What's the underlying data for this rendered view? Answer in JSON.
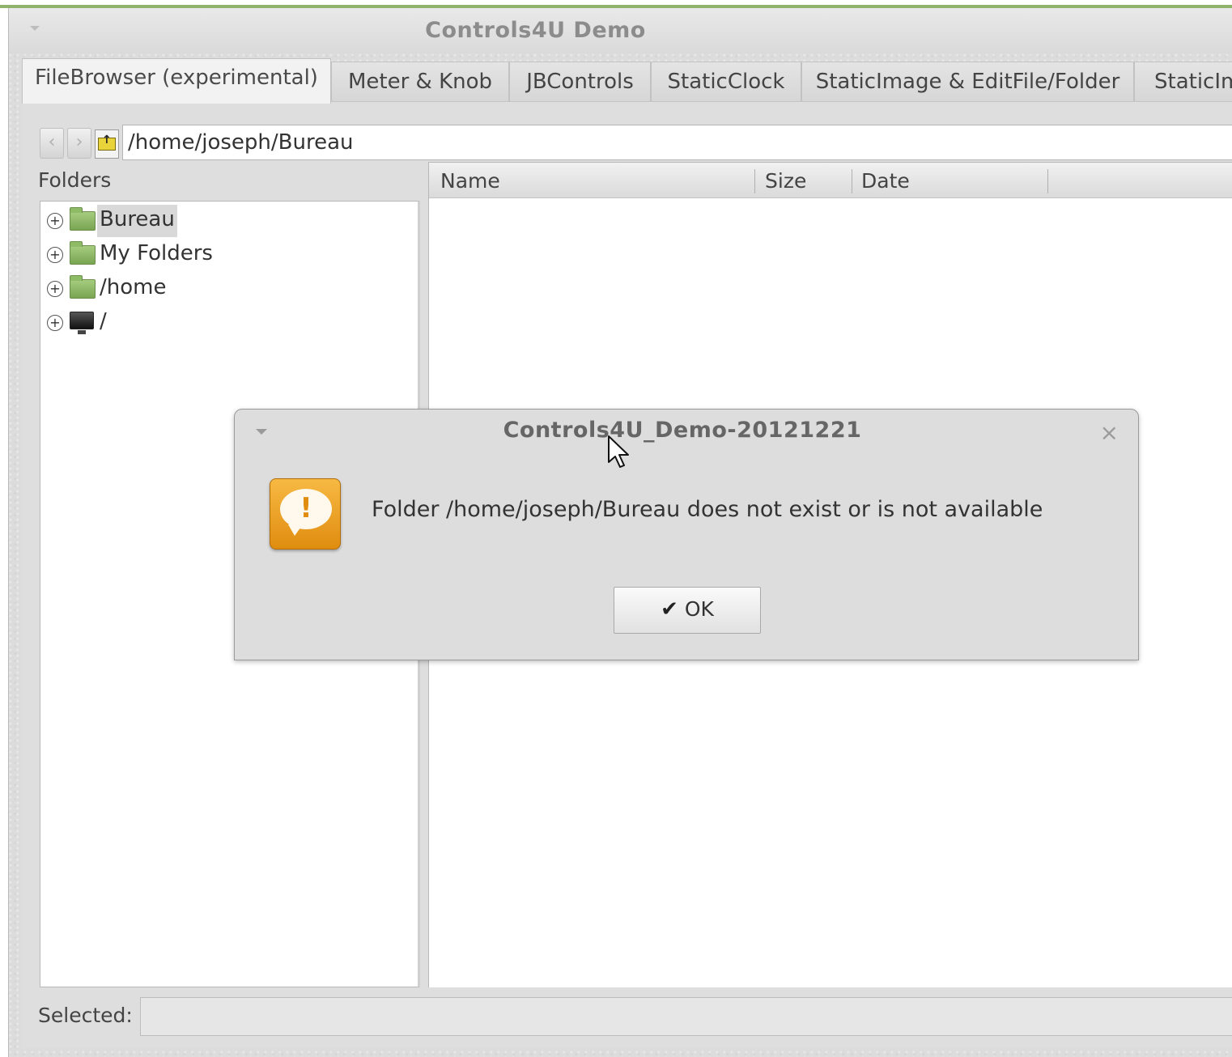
{
  "window": {
    "title": "Controls4U Demo"
  },
  "tabs": [
    {
      "label": "FileBrowser (experimental)",
      "active": true
    },
    {
      "label": "Meter & Knob"
    },
    {
      "label": "JBControls"
    },
    {
      "label": "StaticClock"
    },
    {
      "label": "StaticImage & EditFile/Folder"
    },
    {
      "label": "StaticIm"
    }
  ],
  "file_browser": {
    "path": "/home/joseph/Bureau",
    "back_icon": "chevron-left-icon",
    "forward_icon": "chevron-right-icon",
    "up_icon": "folder-up-icon",
    "folders_label": "Folders",
    "tree": [
      {
        "label": "Bureau",
        "icon": "folder-icon",
        "selected": true
      },
      {
        "label": "My Folders",
        "icon": "folder-icon"
      },
      {
        "label": "/home",
        "icon": "folder-icon"
      },
      {
        "label": "/",
        "icon": "monitor-icon"
      }
    ],
    "columns": [
      "Name",
      "Size",
      "Date"
    ],
    "selected_label": "Selected:",
    "selected_value": ""
  },
  "dialog": {
    "title": "Controls4U_Demo-20121221",
    "close_glyph": "×",
    "message": "Folder /home/joseph/Bureau does not exist or is not available",
    "icon": "warning-icon",
    "ok_label": "OK",
    "ok_check": "✔"
  },
  "colors": {
    "accent_green": "#8fb36a",
    "warning_orange": "#e08d0f",
    "folder_green": "#79a552"
  }
}
